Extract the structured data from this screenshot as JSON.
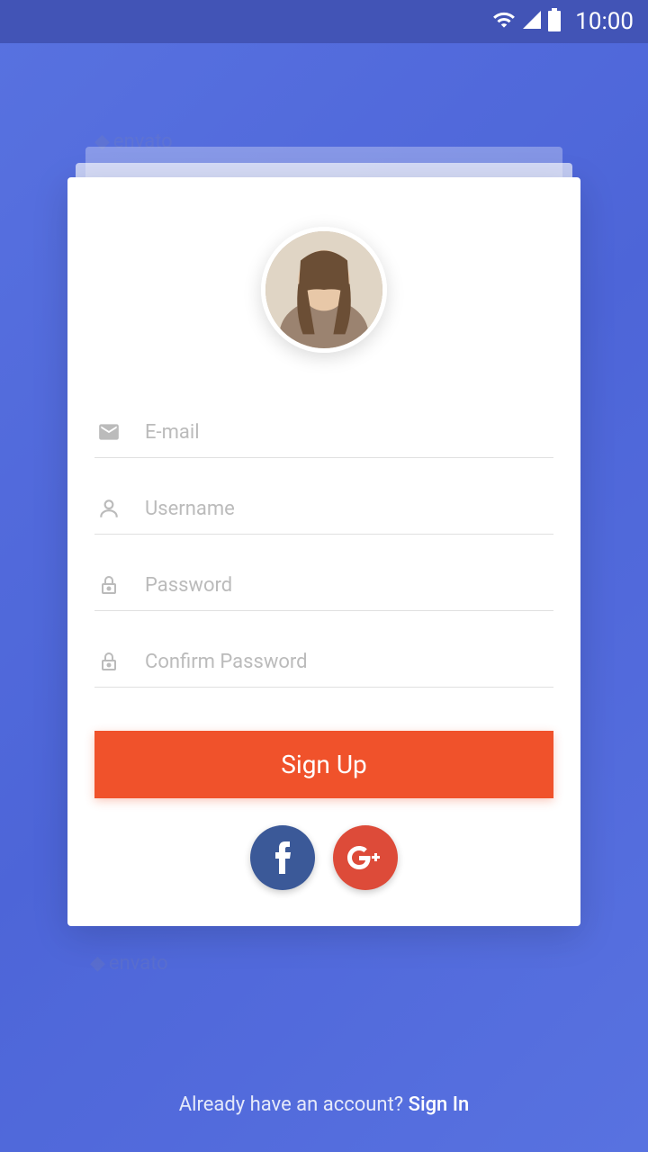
{
  "status": {
    "time": "10:00"
  },
  "watermark": "envato",
  "form": {
    "email_placeholder": "E-mail",
    "username_placeholder": "Username",
    "password_placeholder": "Password",
    "confirm_password_placeholder": "Confirm Password",
    "signup_label": "Sign Up"
  },
  "social": {
    "facebook": "f",
    "google": "G+"
  },
  "footer": {
    "prompt": "Already have an account? ",
    "signin_label": "Sign In"
  }
}
